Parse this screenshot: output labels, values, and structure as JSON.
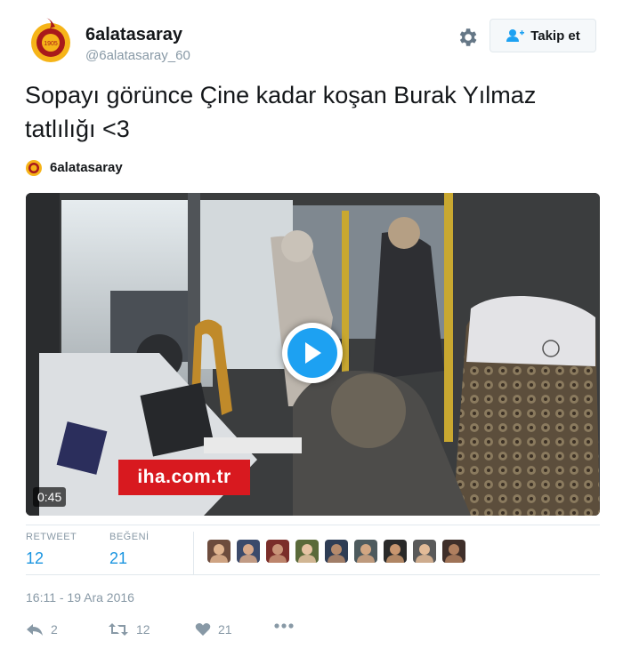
{
  "user": {
    "name": "6alatasaray",
    "handle": "@6alatasaray_60",
    "logo_text": "1905"
  },
  "header": {
    "follow_label": "Takip et",
    "settings_icon": "gear-icon",
    "follow_icon": "add-user-icon"
  },
  "tweet": {
    "text": "Sopayı görünce Çine kadar koşan Burak Yılmaz tatlılığı <3",
    "quote_name": "6alatasaray"
  },
  "media": {
    "duration": "0:45",
    "watermark": "iha.com.tr",
    "play_icon": "play-icon"
  },
  "stats": {
    "retweet_label": "RETWEET",
    "retweet_count": "12",
    "like_label": "BEĞENİ",
    "like_count": "21"
  },
  "likers_count": 9,
  "timestamp": "16:11 - 19 Ara 2016",
  "actions": {
    "reply_count": "2",
    "retweet_count": "12",
    "like_count": "21"
  },
  "colors": {
    "accent": "#1da1f2",
    "link": "#1b95e0",
    "muted": "#8899a6",
    "galatasaray_red": "#a8191b",
    "galatasaray_yellow": "#f6b418"
  }
}
